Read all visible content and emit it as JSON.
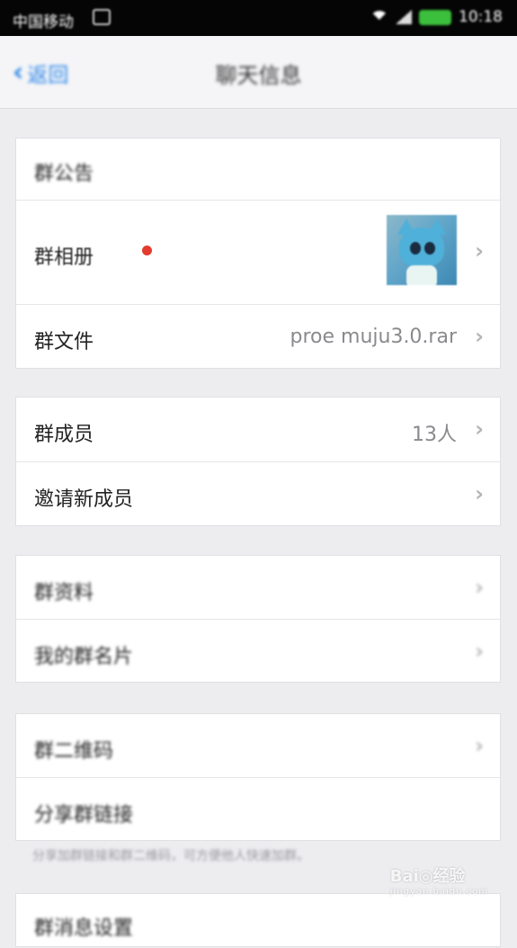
{
  "status_bar": {
    "carrier": "中国移动",
    "time": "10:18"
  },
  "nav": {
    "back_label": "返回",
    "title": "聊天信息"
  },
  "section1": {
    "announcement_label": "群公告",
    "album_label": "群相册",
    "files_label": "群文件",
    "files_value": "proe muju3.0.rar"
  },
  "section2": {
    "members_label": "群成员",
    "members_value": "13人",
    "invite_label": "邀请新成员"
  },
  "section3": {
    "profile_label": "群资料",
    "card_label": "我的群名片"
  },
  "section4": {
    "qrcode_label": "群二维码",
    "share_link_label": "分享群链接",
    "footnote": "分享加群链接和群二维码，可方便他人快速加群。"
  },
  "section5": {
    "notify_label": "群消息设置"
  },
  "watermark": {
    "brand": "Bai◎经验",
    "url": "jingyan.baidu.com"
  },
  "colors": {
    "accent": "#2b86e8",
    "badge": "#e33b2e"
  }
}
